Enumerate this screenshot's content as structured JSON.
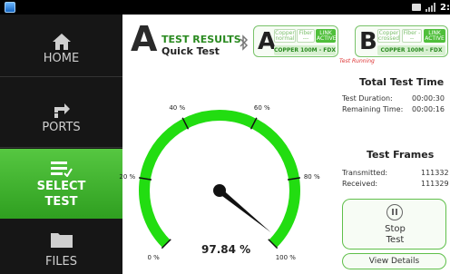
{
  "statusbar": {
    "time": "2:"
  },
  "sidebar": {
    "items": [
      {
        "label": "HOME",
        "icon": "home-icon"
      },
      {
        "label": "PORTS",
        "icon": "ports-icon"
      },
      {
        "label_line1": "SELECT",
        "label_line2": "TEST",
        "icon": "select-test-icon",
        "active": true
      },
      {
        "label": "FILES",
        "icon": "folder-icon"
      }
    ]
  },
  "header": {
    "port_letter": "A",
    "title": "TEST RESULTS",
    "subtitle": "Quick Test",
    "ports": [
      {
        "letter": "A",
        "copper": "Copper normal",
        "fiber": "Fiber ---",
        "link": "LINK ACTIVE",
        "speed": "COPPER 100M - FDX"
      },
      {
        "letter": "B",
        "copper": "Copper crossed",
        "fiber": "Fiber ---",
        "link": "LINK ACTIVE",
        "speed": "COPPER 100M - FDX"
      }
    ],
    "status": "Test Running"
  },
  "gauge": {
    "value": 97.84,
    "value_text": "97.84 %",
    "ticks": [
      "0 %",
      "20 %",
      "40 %",
      "60 %",
      "80 %",
      "100 %"
    ],
    "color": "#22dd11"
  },
  "summary": {
    "time_title": "Total Test Time",
    "duration_label": "Test Duration:",
    "duration_value": "00:00:30",
    "remaining_label": "Remaining Time:",
    "remaining_value": "00:00:16",
    "frames_title": "Test Frames",
    "transmitted_label": "Transmitted:",
    "transmitted_value": "111332",
    "received_label": "Received:",
    "received_value": "111329"
  },
  "buttons": {
    "stop_line1": "Stop",
    "stop_line2": "Test",
    "details": "View Details"
  }
}
